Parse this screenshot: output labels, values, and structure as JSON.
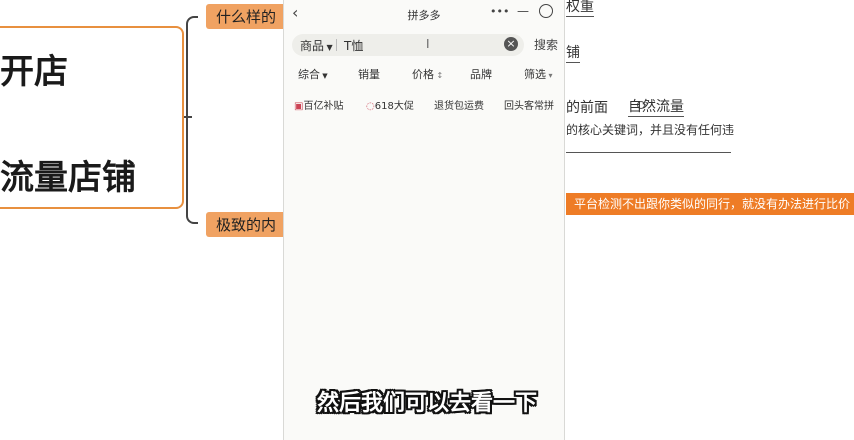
{
  "mindmap": {
    "center_line1": "开店",
    "center_line2": "流量店铺",
    "branch_top": "什么样的",
    "branch_bottom": "极致的内",
    "right_top_fragment": "权重",
    "right_store_fragment": "铺",
    "right_front": "的前面",
    "right_natural": "自然流量",
    "right_keyword": "的核心关键词，并且没有任何违",
    "banner": "平台检测不出跟你类似的同行，就没有办法进行比价"
  },
  "phone": {
    "title": "拼多多",
    "search": {
      "category": "商品",
      "value": "T恤",
      "button": "搜索"
    },
    "filters": [
      "综合",
      "销量",
      "价格",
      "品牌",
      "筛选"
    ],
    "tags": [
      "百亿补贴",
      "618大促",
      "退货包运费",
      "回头客常拼"
    ]
  },
  "subtitle": "然后我们可以去看一下",
  "colors": {
    "accent": "#ee7c26",
    "branch": "#f0a262"
  }
}
